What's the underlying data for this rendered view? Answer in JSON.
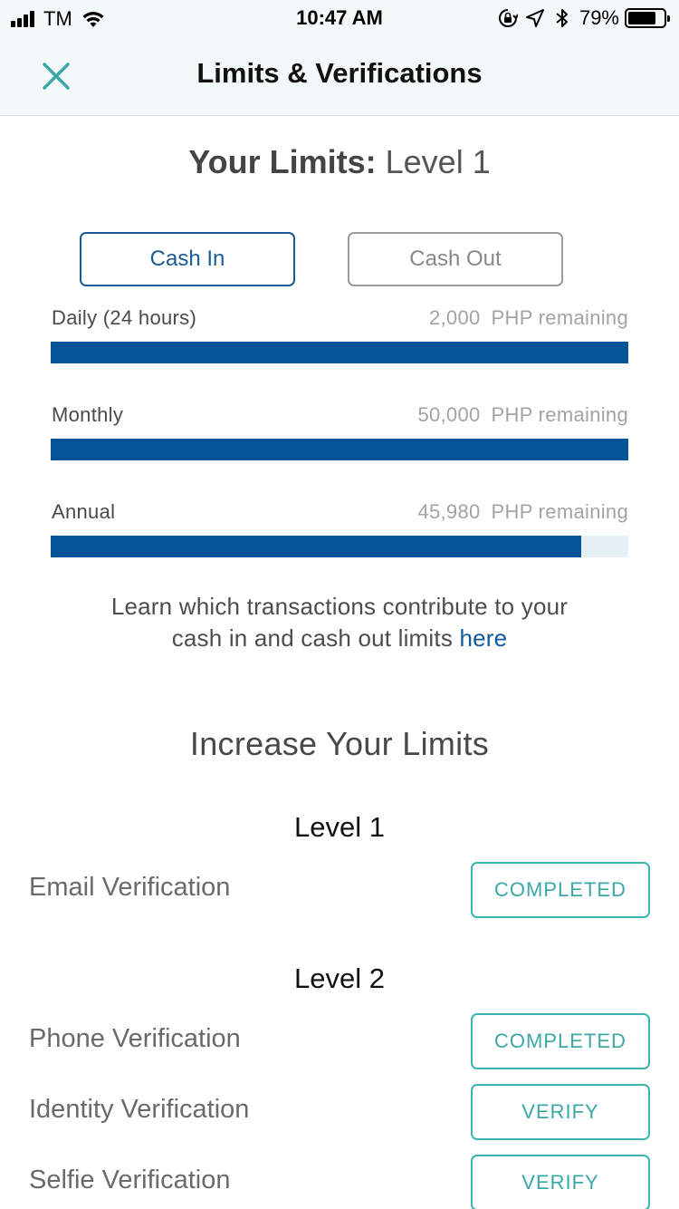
{
  "status_bar": {
    "carrier": "TM",
    "time": "10:47 AM",
    "battery_percent": "79%",
    "battery_level": 0.79,
    "icons": [
      "signal-icon",
      "wifi-icon",
      "orientation-lock-icon",
      "location-arrow-icon",
      "bluetooth-icon",
      "battery-icon"
    ]
  },
  "header": {
    "title": "Limits & Verifications",
    "close_icon": "close-icon"
  },
  "limits": {
    "title_bold": "Your Limits:",
    "title_level": "Level 1",
    "tabs": [
      {
        "label": "Cash In",
        "active": true
      },
      {
        "label": "Cash Out",
        "active": false
      }
    ],
    "rows": [
      {
        "name": "Daily (24 hours)",
        "amount": "2,000",
        "suffix": "PHP remaining",
        "fraction_remaining": 1.0
      },
      {
        "name": "Monthly",
        "amount": "50,000",
        "suffix": "PHP remaining",
        "fraction_remaining": 1.0
      },
      {
        "name": "Annual",
        "amount": "45,980",
        "suffix": "PHP remaining",
        "fraction_remaining": 0.919
      }
    ],
    "learn_text": "Learn which transactions contribute to your",
    "learn_text_2": "cash in and cash out limits",
    "learn_link": "here"
  },
  "increase": {
    "title": "Increase Your Limits",
    "levels": [
      {
        "name": "Level 1",
        "items": [
          {
            "label": "Email Verification",
            "action": "COMPLETED"
          }
        ]
      },
      {
        "name": "Level 2",
        "items": [
          {
            "label": "Phone Verification",
            "action": "COMPLETED"
          },
          {
            "label": "Identity Verification",
            "action": "VERIFY"
          },
          {
            "label": "Selfie Verification",
            "action": "VERIFY"
          }
        ]
      }
    ]
  },
  "colors": {
    "primary_blue": "#045499",
    "teal": "#3bb5b1",
    "header_bg": "#f3f8f9"
  }
}
